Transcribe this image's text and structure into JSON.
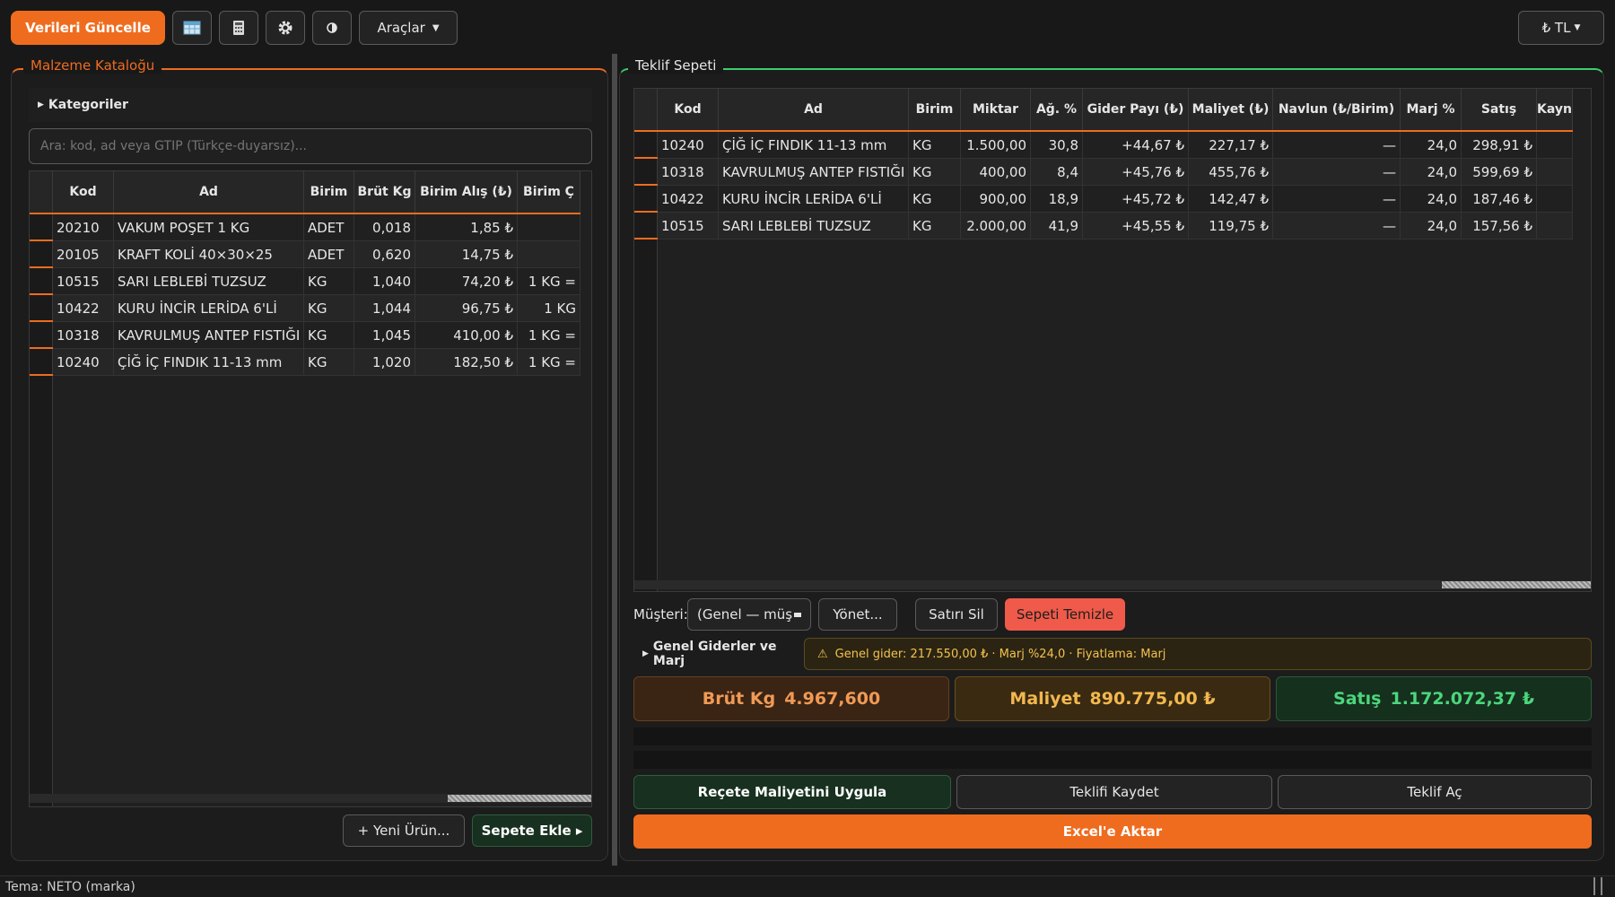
{
  "toolbar": {
    "refresh_label": "Verileri Güncelle",
    "tools_label": "Araçlar",
    "currency_label": "₺ TL"
  },
  "catalog": {
    "title": "Malzeme Kataloğu",
    "categories_label": "Kategoriler",
    "search_placeholder": "Ara: kod, ad veya GTIP (Türkçe-duyarsız)...",
    "columns": [
      "Kod",
      "Ad",
      "Birim",
      "Brüt Kg",
      "Birim Alış (₺)",
      "Birim Ç"
    ],
    "rows": [
      [
        "20210",
        "VAKUM POŞET 1 KG",
        "ADET",
        "0,018",
        "1,85 ₺",
        ""
      ],
      [
        "20105",
        "KRAFT KOLİ 40×30×25",
        "ADET",
        "0,620",
        "14,75 ₺",
        ""
      ],
      [
        "10515",
        "SARI LEBLEBİ TUZSUZ",
        "KG",
        "1,040",
        "74,20 ₺",
        "1 KG ="
      ],
      [
        "10422",
        "KURU İNCİR LERİDA 6'Lİ",
        "KG",
        "1,044",
        "96,75 ₺",
        "1 KG"
      ],
      [
        "10318",
        "KAVRULMUŞ ANTEP FISTIĞI",
        "KG",
        "1,045",
        "410,00 ₺",
        "1 KG ="
      ],
      [
        "10240",
        "ÇİĞ İÇ FINDIK 11-13 mm",
        "KG",
        "1,020",
        "182,50 ₺",
        "1 KG ="
      ]
    ],
    "new_product_label": "+ Yeni Ürün...",
    "add_to_cart_label": "Sepete Ekle ▸"
  },
  "cart": {
    "title": "Teklif Sepeti",
    "columns": [
      "Kod",
      "Ad",
      "Birim",
      "Miktar",
      "Ağ. %",
      "Gider Payı (₺)",
      "Maliyet (₺)",
      "Navlun (₺/Birim)",
      "Marj %",
      "Satış",
      "Kayn"
    ],
    "rows": [
      [
        "10240",
        "ÇİĞ İÇ FINDIK 11-13 mm",
        "KG",
        "1.500,00",
        "30,8",
        "+44,67 ₺",
        "227,17 ₺",
        "—",
        "24,0",
        "298,91 ₺",
        ""
      ],
      [
        "10318",
        "KAVRULMUŞ ANTEP FISTIĞI",
        "KG",
        "400,00",
        "8,4",
        "+45,76 ₺",
        "455,76 ₺",
        "—",
        "24,0",
        "599,69 ₺",
        ""
      ],
      [
        "10422",
        "KURU İNCİR LERİDA 6'Lİ",
        "KG",
        "900,00",
        "18,9",
        "+45,72 ₺",
        "142,47 ₺",
        "—",
        "24,0",
        "187,46 ₺",
        ""
      ],
      [
        "10515",
        "SARI LEBLEBİ TUZSUZ",
        "KG",
        "2.000,00",
        "41,9",
        "+45,55 ₺",
        "119,75 ₺",
        "—",
        "24,0",
        "157,56 ₺",
        ""
      ]
    ],
    "customer_label": "Müşteri:",
    "customer_value": "(Genel — müş",
    "manage_label": "Yönet...",
    "delete_row_label": "Satırı Sil",
    "clear_cart_label": "Sepeti Temizle",
    "overhead_label": "Genel Giderler ve Marj",
    "overhead_info": "Genel gider: 217.550,00 ₺ · Marj %24,0 · Fiyatlama: Marj",
    "gross_kg_label": "Brüt Kg",
    "gross_kg_value": "4.967,600",
    "cost_label": "Maliyet",
    "cost_value": "890.775,00 ₺",
    "sales_label": "Satış",
    "sales_value": "1.172.072,37 ₺",
    "apply_recipe_label": "Reçete Maliyetini Uygula",
    "save_quote_label": "Teklifi Kaydet",
    "open_quote_label": "Teklif Aç",
    "export_excel_label": "Excel'e Aktar"
  },
  "status": {
    "theme": "Tema: NETO (marka)"
  },
  "colors": {
    "accent": "#ef6c1f",
    "green": "#3ccf6e",
    "danger": "#ef5a4a"
  }
}
